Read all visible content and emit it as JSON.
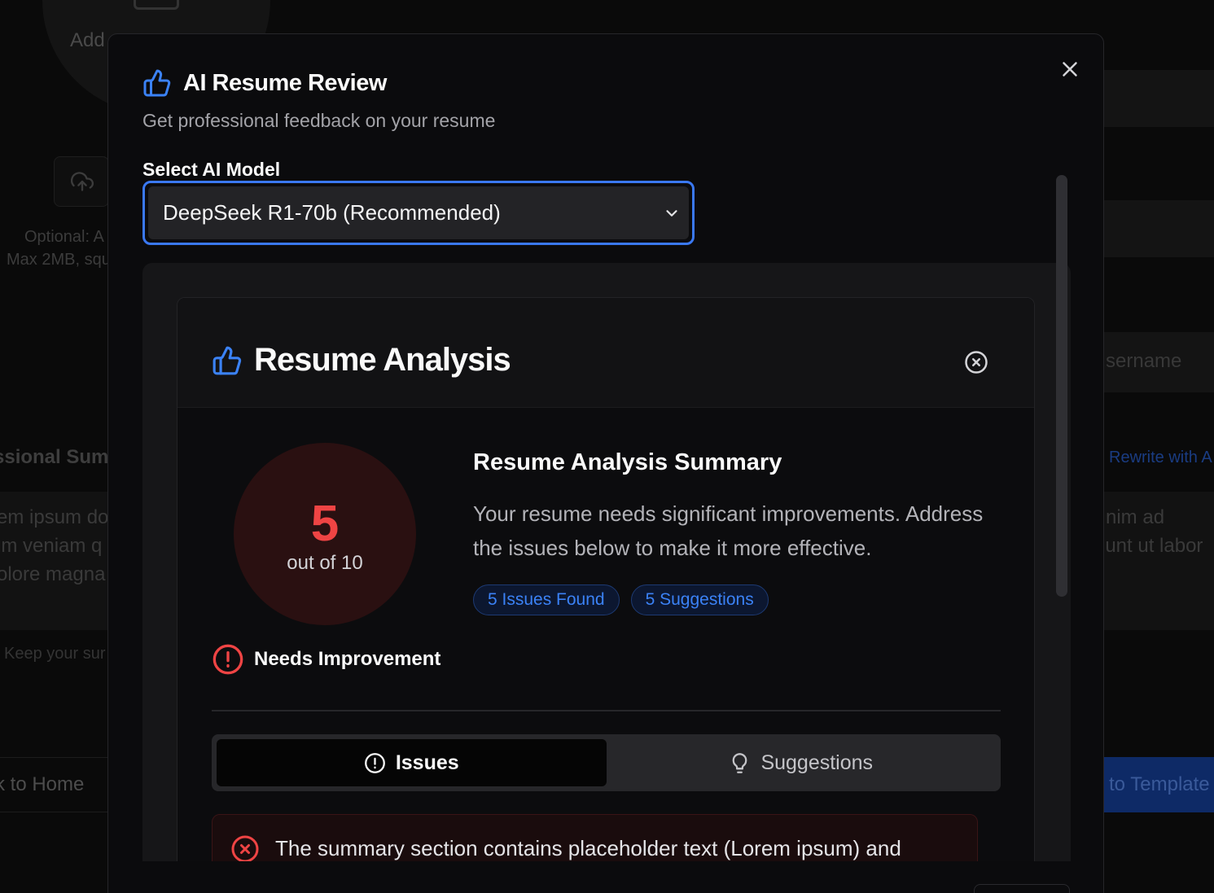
{
  "background": {
    "add_label": "Add",
    "optional_line1": "Optional: A",
    "optional_line2": "Max 2MB, squ",
    "summary_title": "ssional Summ",
    "lorem_left": [
      "em ipsum do",
      "im veniam q",
      "olore magna"
    ],
    "lorem_right": [
      "nim ad",
      "lunt ut labor"
    ],
    "keep_hint": "Keep your sur",
    "back_home": "k to Home",
    "username": "sername",
    "rewrite": "Rewrite with A",
    "to_template": "to Template"
  },
  "modal": {
    "title": "AI Resume Review",
    "subtitle": "Get professional feedback on your resume",
    "model_label": "Select AI Model",
    "model_selected": "DeepSeek R1-70b (Recommended)"
  },
  "analysis": {
    "title": "Resume Analysis",
    "score": "5",
    "score_of": "out of 10",
    "status": "Needs Improvement",
    "summary_title": "Resume Analysis Summary",
    "summary_text": "Your resume needs significant improvements. Address the issues below to make it more effective.",
    "badges": [
      "5 Issues Found",
      "5 Suggestions"
    ],
    "tabs": [
      "Issues",
      "Suggestions"
    ],
    "issue_text": "The summary section contains placeholder text (Lorem ipsum) and"
  },
  "colors": {
    "accent": "#3b82f6",
    "danger": "#ef4444",
    "modal_bg": "#0b0b0d"
  },
  "icons": [
    "thumbs-up-icon",
    "close-icon",
    "chevron-down-icon",
    "circle-x-icon",
    "alert-circle-icon",
    "lightbulb-icon",
    "upload-cloud-icon"
  ]
}
